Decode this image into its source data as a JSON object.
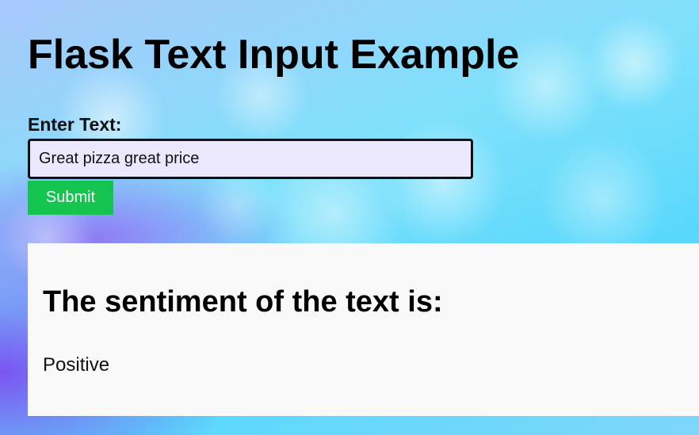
{
  "page": {
    "title": "Flask Text Input Example"
  },
  "form": {
    "label": "Enter Text:",
    "input_value": "Great pizza great price",
    "submit_label": "Submit"
  },
  "result": {
    "heading": "The sentiment of the text is:",
    "value": "Positive"
  },
  "colors": {
    "submit_background": "#13c44f",
    "input_background": "#ebe8fd",
    "panel_background": "#f9f9fa"
  }
}
